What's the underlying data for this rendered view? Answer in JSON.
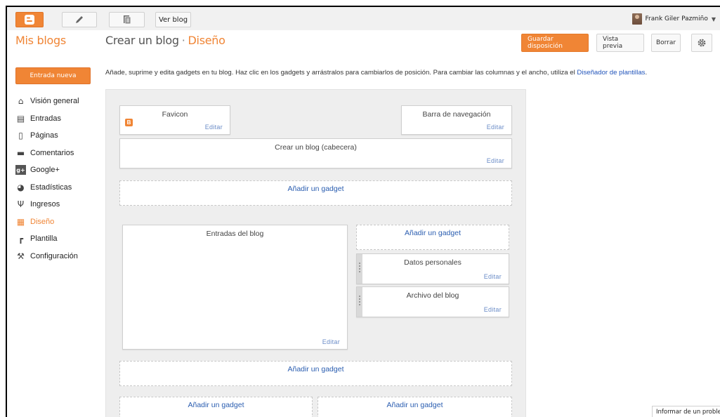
{
  "topbar": {
    "blogger_icon": "blogger-logo-icon",
    "pencil_icon": "pencil-icon",
    "posts_icon": "documents-icon",
    "view_blog_label": "Ver blog",
    "user_name": "Frank Giler Pazmiño",
    "user_menu_icon": "caret-down-icon"
  },
  "header": {
    "brand": "Mis blogs",
    "blog_name": "Crear un blog",
    "separator": "·",
    "section": "Diseño",
    "save_label": "Guardar disposición",
    "preview_label": "Vista previa",
    "clear_label": "Borrar",
    "settings_icon": "gear-icon"
  },
  "sidebar": {
    "new_post_label": "Entrada nueva",
    "items": [
      {
        "label": "Visión general",
        "icon": "home-icon"
      },
      {
        "label": "Entradas",
        "icon": "document-icon"
      },
      {
        "label": "Páginas",
        "icon": "page-icon"
      },
      {
        "label": "Comentarios",
        "icon": "comment-icon"
      },
      {
        "label": "Google+",
        "icon": "google-plus-icon"
      },
      {
        "label": "Estadísticas",
        "icon": "pie-chart-icon"
      },
      {
        "label": "Ingresos",
        "icon": "trophy-icon"
      },
      {
        "label": "Diseño",
        "icon": "layout-icon"
      },
      {
        "label": "Plantilla",
        "icon": "paint-roller-icon"
      },
      {
        "label": "Configuración",
        "icon": "wrench-icon"
      }
    ],
    "active_index": 7
  },
  "main": {
    "intro_text": "Añade, suprime y edita gadgets en tu blog. Haz clic en los gadgets y arrástralos para cambiarlos de posición. Para cambiar las columnas y el ancho, utiliza el ",
    "intro_link": "Diseñador de plantillas",
    "intro_end": ".",
    "edit_label": "Editar",
    "add_gadget_label": "Añadir un gadget",
    "gadgets": {
      "favicon": "Favicon",
      "navbar": "Barra de navegación",
      "header": "Crear un blog (cabecera)",
      "blog_posts": "Entradas del blog",
      "profile": "Datos personales",
      "archive": "Archivo del blog"
    }
  },
  "footer": {
    "report_label": "Informar de un problema"
  },
  "colors": {
    "accent": "#f08535",
    "link": "#2a5db0"
  }
}
